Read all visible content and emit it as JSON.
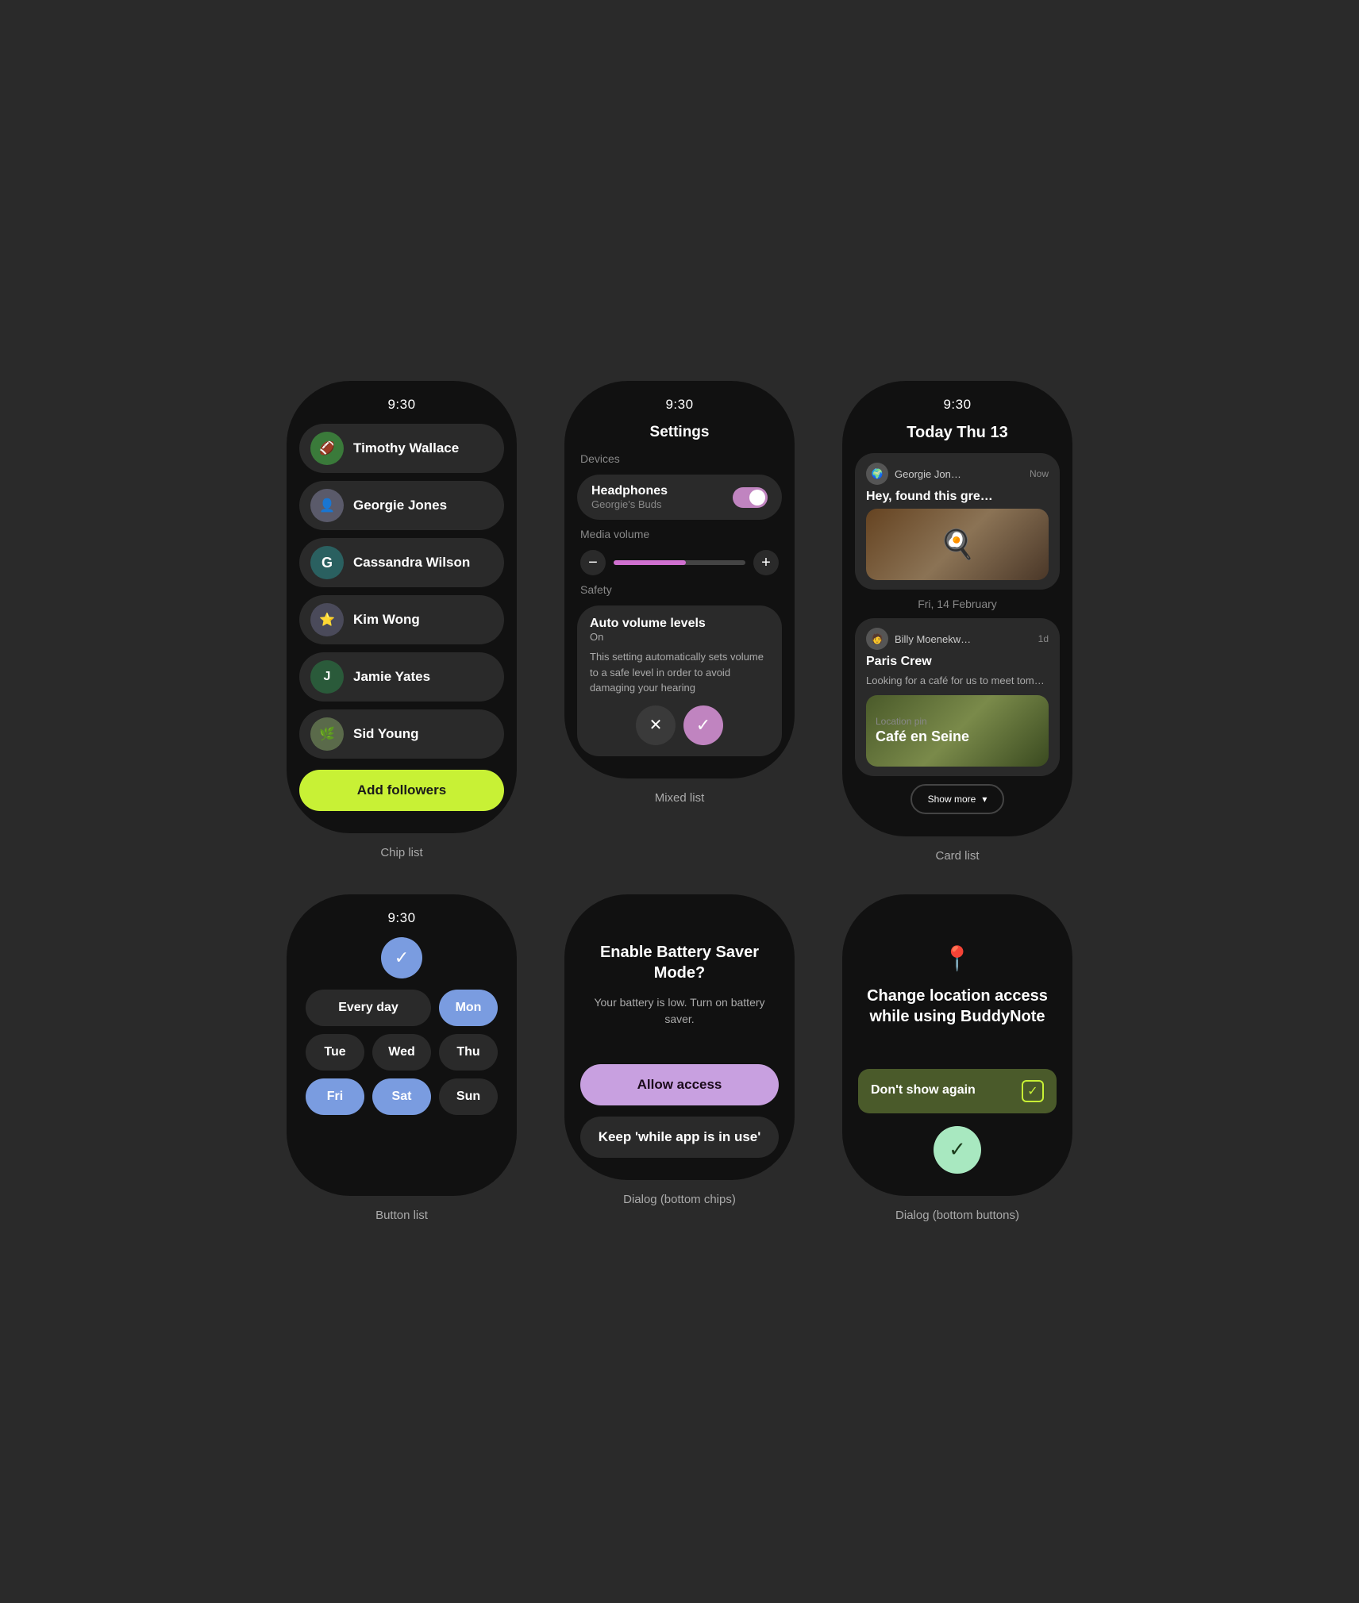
{
  "grid": {
    "top_row": [
      {
        "label": "Chip list",
        "time": "9:30",
        "contacts": [
          {
            "name": "Timothy Wallace",
            "avatar_type": "image",
            "avatar_class": "av-timothy",
            "emoji": "🏈"
          },
          {
            "name": "Georgie Jones",
            "avatar_type": "image",
            "avatar_class": "av-georgie",
            "emoji": "👤"
          },
          {
            "name": "Cassandra Wilson",
            "avatar_type": "initial",
            "avatar_class": "av-cassandra",
            "initial": "G"
          },
          {
            "name": "Kim Wong",
            "avatar_type": "image",
            "avatar_class": "av-kim",
            "emoji": "⭐"
          },
          {
            "name": "Jamie Yates",
            "avatar_type": "initial",
            "avatar_class": "av-jamie",
            "initial": "J"
          },
          {
            "name": "Sid Young",
            "avatar_type": "image",
            "avatar_class": "av-sid",
            "emoji": "🌿"
          }
        ],
        "add_btn": "Add followers"
      },
      {
        "label": "Mixed list",
        "time": "9:30",
        "title": "Settings",
        "devices_section": "Devices",
        "headphones_name": "Headphones",
        "headphones_subtitle": "Georgie's Buds",
        "media_volume_label": "Media volume",
        "safety_label": "Safety",
        "auto_vol_title": "Auto volume levels",
        "auto_vol_status": "On",
        "auto_vol_desc": "This setting automatically sets volume to a safe level in order to avoid damaging your hearing"
      },
      {
        "label": "Card list",
        "time": "9:30",
        "today_label": "Today Thu 13",
        "notif1_name": "Georgie Jon…",
        "notif1_time": "Now",
        "notif1_title": "Hey, found this gre…",
        "date_divider": "Fri, 14 February",
        "notif2_name": "Billy Moenekw…",
        "notif2_time": "1d",
        "notif2_group": "Paris Crew",
        "notif2_body": "Looking for a café for us to meet tom…",
        "location_label": "Location pin",
        "location_name": "Café en Seine",
        "show_more": "Show more"
      }
    ],
    "bottom_row": [
      {
        "label": "Button list",
        "time": "9:30",
        "days": [
          {
            "label": "Every day",
            "style": "wide dark"
          },
          {
            "label": "Mon",
            "style": "light"
          },
          {
            "label": "Tue",
            "style": "dark"
          },
          {
            "label": "Wed",
            "style": "dark"
          },
          {
            "label": "Thu",
            "style": "dark"
          },
          {
            "label": "Fri",
            "style": "light"
          },
          {
            "label": "Sat",
            "style": "light"
          },
          {
            "label": "Sun",
            "style": "dark"
          }
        ]
      },
      {
        "label": "Dialog (bottom chips)",
        "title": "Enable Battery Saver Mode?",
        "body": "Your battery is low. Turn on battery saver.",
        "btn_primary": "Allow access",
        "btn_secondary": "Keep 'while app is in use'"
      },
      {
        "label": "Dialog (bottom buttons)",
        "icon": "📍",
        "title": "Change location access while using BuddyNote",
        "dont_show_label": "Don't show again",
        "confirm_icon": "✓"
      }
    ]
  }
}
